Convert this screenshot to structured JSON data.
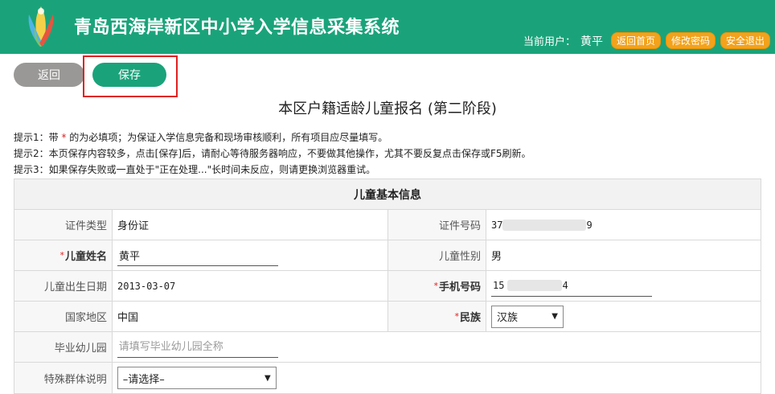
{
  "header": {
    "title": "青岛西海岸新区中小学入学信息采集系统",
    "current_user_label": "当前用户：",
    "current_user": "黄平",
    "buttons": {
      "home": "返回首页",
      "change_password": "修改密码",
      "logout": "安全退出"
    }
  },
  "toolbar": {
    "back_label": "返回",
    "save_label": "保存"
  },
  "page_title": "本区户籍适龄儿童报名 (第二阶段)",
  "tips": {
    "tip1_before": "提示1：带 ",
    "tip1_star": "*",
    "tip1_after": " 的为必填项；为保证入学信息完备和现场审核顺利，所有项目应尽量填写。",
    "tip2": "提示2：本页保存内容较多，点击[保存]后，请耐心等待服务器响应，不要做其他操作，尤其不要反复点击保存或F5刷新。",
    "tip3": "提示3：如果保存失败或一直处于\"正在处理...\"长时间未反应，则请更换浏览器重试。"
  },
  "form": {
    "section_title": "儿童基本信息",
    "id_type_label": "证件类型",
    "id_type_value": "身份证",
    "id_number_label": "证件号码",
    "id_number_start": "37",
    "id_number_end": "9",
    "child_name_label": "儿童姓名",
    "child_name_value": "黄平",
    "gender_label": "儿童性别",
    "gender_value": "男",
    "birth_label": "儿童出生日期",
    "birth_value": "2013-03-07",
    "phone_label": "手机号码",
    "phone_start": "15",
    "phone_end": "4",
    "country_label": "国家地区",
    "country_value": "中国",
    "ethnicity_label": "民族",
    "ethnicity_value": "汉族",
    "kindergarten_label": "毕业幼儿园",
    "kindergarten_placeholder": "请填写毕业幼儿园全称",
    "special_group_label": "特殊群体说明",
    "special_group_value": "–请选择–",
    "required_star": "*"
  },
  "colors": {
    "brand": "#1aa37a",
    "accent": "#f3a21b",
    "required": "#e02020"
  }
}
